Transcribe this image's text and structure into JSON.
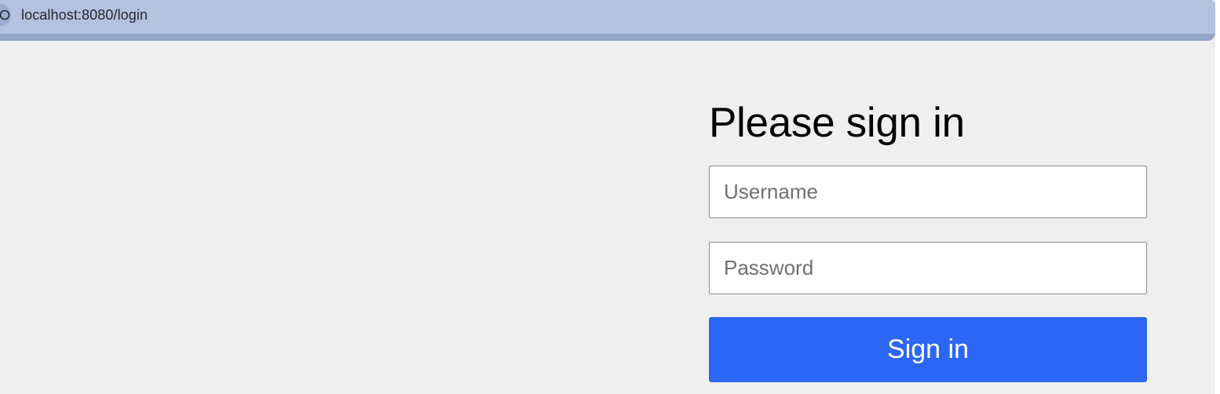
{
  "browser": {
    "url": "localhost:8080/login",
    "site_info_icon": "site-info-icon"
  },
  "login": {
    "heading": "Please sign in",
    "username_placeholder": "Username",
    "username_value": "",
    "password_placeholder": "Password",
    "password_value": "",
    "submit_label": "Sign in"
  },
  "colors": {
    "address_bar": "#b3c2de",
    "page_background": "#efefef",
    "submit_button": "#2c66f4"
  }
}
